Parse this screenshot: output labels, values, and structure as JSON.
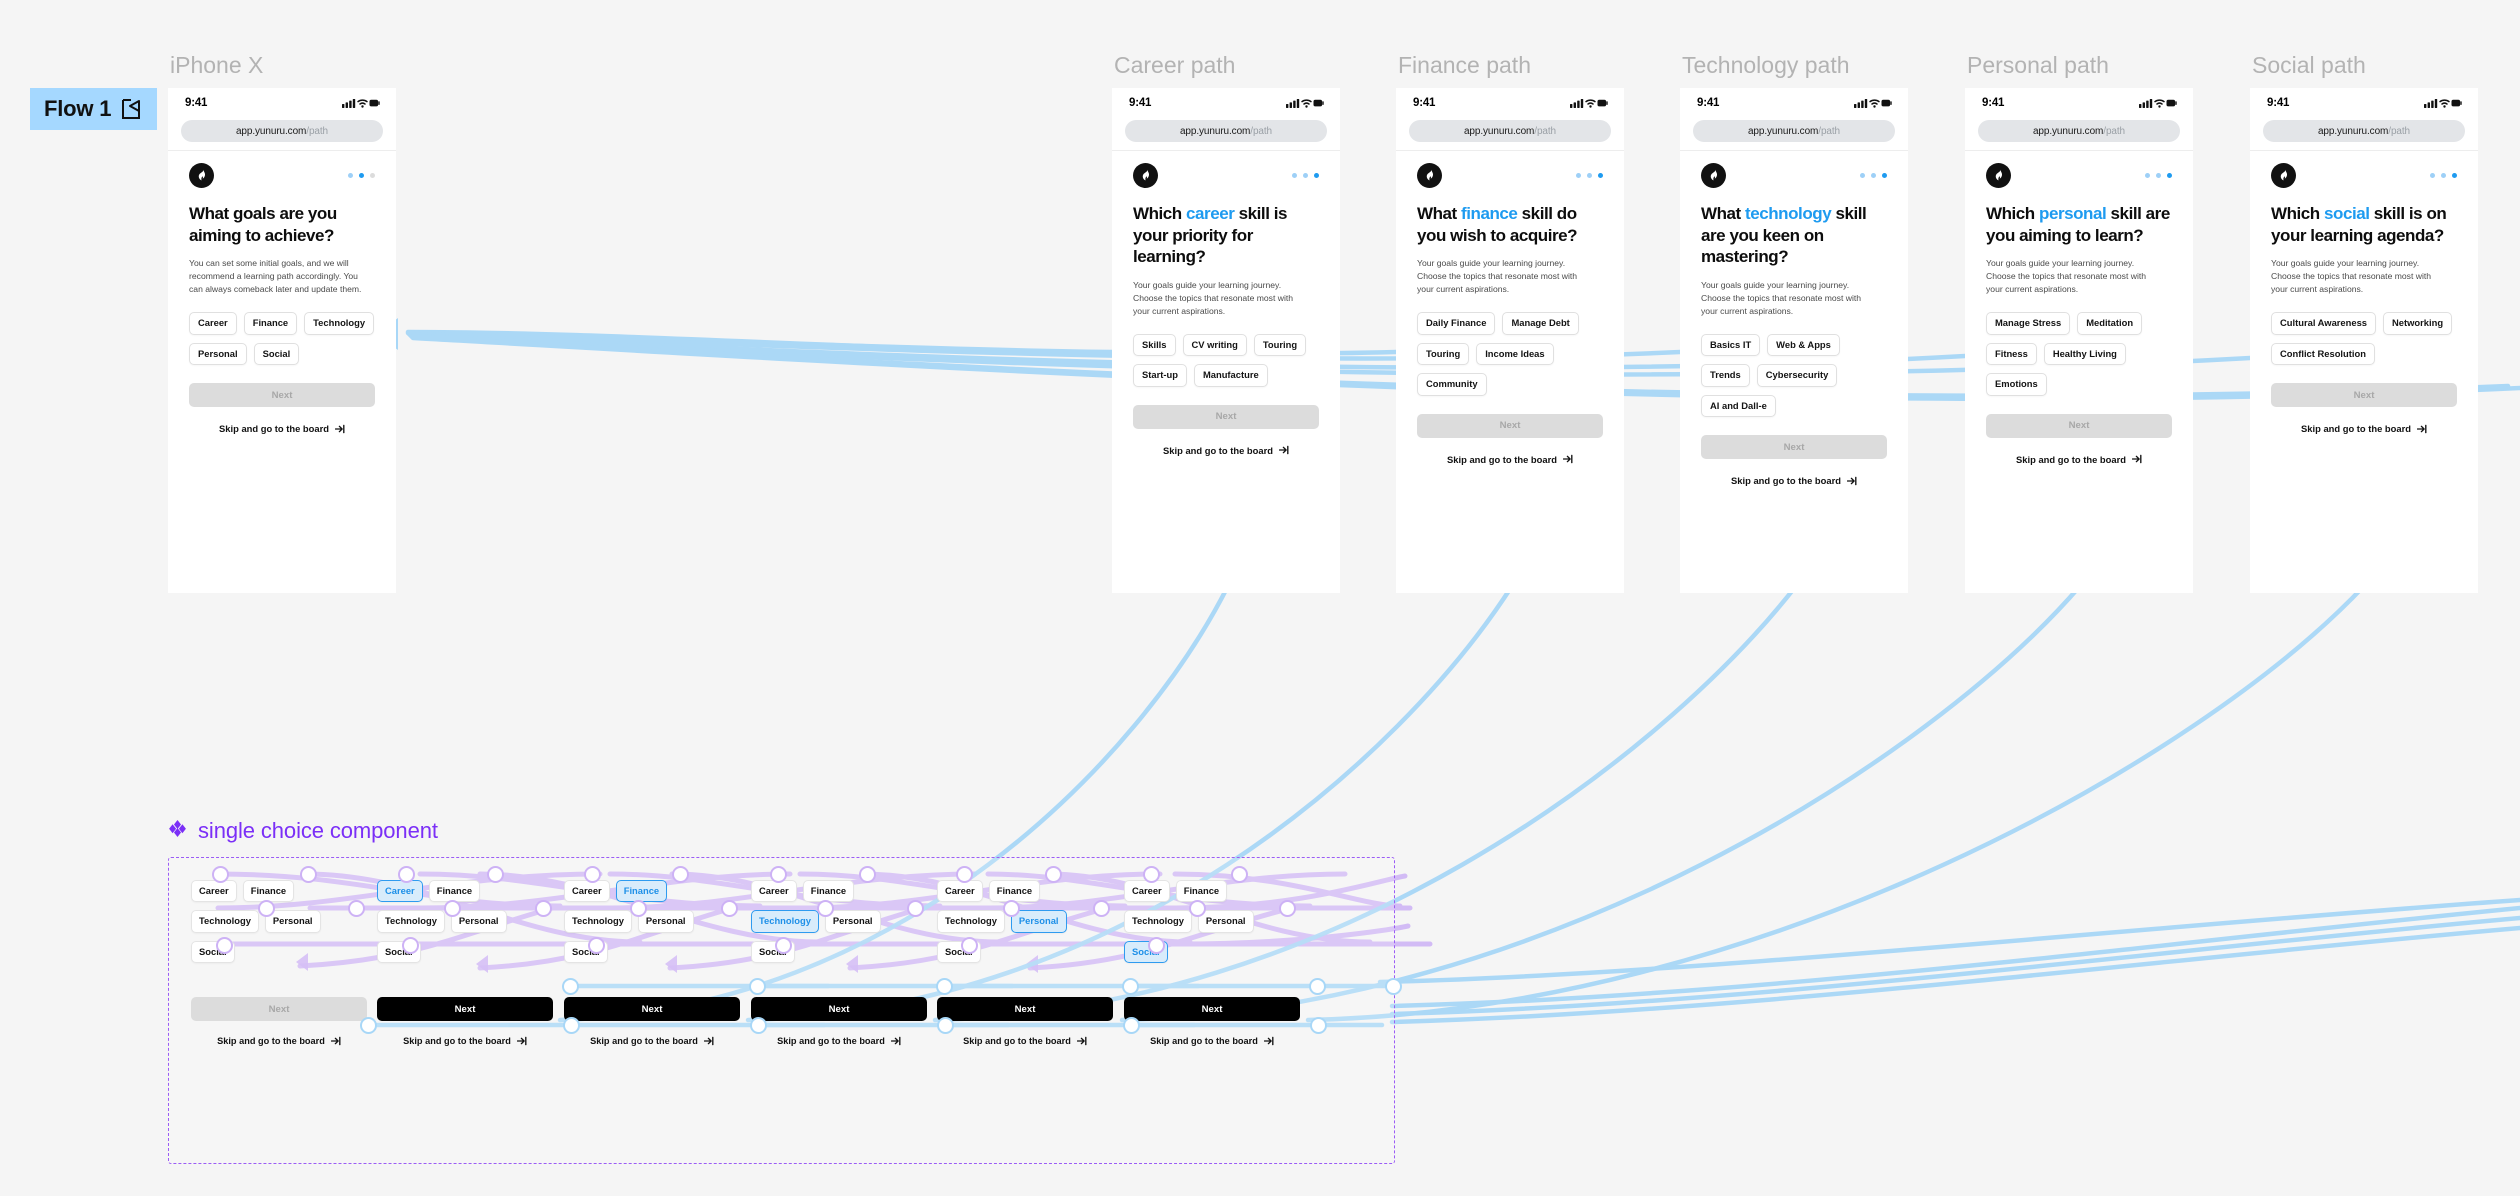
{
  "flow": {
    "badge_label": "Flow 1",
    "play_icon": "flow-play-icon"
  },
  "shared": {
    "status_time": "9:41",
    "url_main": "app.yunuru.com",
    "url_path": "/path",
    "next_label": "Next",
    "skip_label": "Skip and go to the board",
    "logo_icon": "flame-logo-icon",
    "subtext_paths": "Your goals guide your learning journey. Choose the topics that resonate most with your current aspirations.",
    "accent_blue": "#1e9bf0",
    "badge_blue": "#a5d8ff",
    "component_purple": "#7b2ff7",
    "wire_blue": "#a8d7f7",
    "wire_purple": "#cdb2f5"
  },
  "frames": [
    {
      "title": "iPhone X",
      "dots": [
        "light",
        "active",
        "inactive"
      ],
      "headline_pre": "What goals are you aiming to achieve?",
      "headline_parts": {
        "before": "What goals are you aiming to achieve?",
        "highlight": "",
        "after": ""
      },
      "subtext": "You can set some initial goals, and we will recommend a learning path accordingly. You can always comeback later and update them.",
      "chips": [
        "Career",
        "Finance",
        "Technology",
        "Personal",
        "Social"
      ]
    },
    {
      "title": "Career path",
      "dots": [
        "light",
        "light",
        "active"
      ],
      "headline_parts": {
        "before": "Which ",
        "highlight": "career",
        "after": " skill is your priority for learning?"
      },
      "subtext": "Your goals guide your learning journey. Choose the topics that resonate most with your current aspirations.",
      "chips": [
        "Skills",
        "CV writing",
        "Touring",
        "Start-up",
        "Manufacture"
      ]
    },
    {
      "title": "Finance path",
      "dots": [
        "light",
        "light",
        "active"
      ],
      "headline_parts": {
        "before": "What ",
        "highlight": "finance",
        "after": " skill do you wish to acquire?"
      },
      "subtext": "Your goals guide your learning journey. Choose the topics that resonate most with your current aspirations.",
      "chips": [
        "Daily Finance",
        "Manage Debt",
        "Touring",
        "Income Ideas",
        "Community"
      ]
    },
    {
      "title": "Technology path",
      "dots": [
        "light",
        "light",
        "active"
      ],
      "headline_parts": {
        "before": "What ",
        "highlight": "technology",
        "after": " skill are you keen on mastering?"
      },
      "subtext": "Your goals guide your learning journey. Choose the topics that resonate most with your current aspirations.",
      "chips": [
        "Basics IT",
        "Web & Apps",
        "Trends",
        "Cybersecurity",
        "AI and Dall-e"
      ]
    },
    {
      "title": "Personal path",
      "dots": [
        "light",
        "light",
        "active"
      ],
      "headline_parts": {
        "before": "Which ",
        "highlight": "personal",
        "after": " skill are you aiming to learn?"
      },
      "subtext": "Your goals guide your learning journey. Choose the topics that resonate most with your current aspirations.",
      "chips": [
        "Manage Stress",
        "Meditation",
        "Fitness",
        "Healthy Living",
        "Emotions"
      ]
    },
    {
      "title": "Social path",
      "dots": [
        "light",
        "light",
        "active"
      ],
      "headline_parts": {
        "before": "Which ",
        "highlight": "social",
        "after": " skill is on your learning agenda?"
      },
      "subtext": "Your goals guide your learning journey. Choose the topics that resonate most with your current aspirations.",
      "chips": [
        "Cultural Awareness",
        "Networking",
        "Conflict Resolution"
      ]
    }
  ],
  "component": {
    "heading": "single choice component",
    "heading_icon": "component-diamond-icon",
    "options": [
      "Career",
      "Finance",
      "Technology",
      "Personal",
      "Social"
    ],
    "variants": [
      {
        "selected": null,
        "next_state": "disabled"
      },
      {
        "selected": "Career",
        "next_state": "active"
      },
      {
        "selected": "Finance",
        "next_state": "active"
      },
      {
        "selected": "Technology",
        "next_state": "active"
      },
      {
        "selected": "Personal",
        "next_state": "active"
      },
      {
        "selected": "Social",
        "next_state": "active"
      }
    ]
  }
}
